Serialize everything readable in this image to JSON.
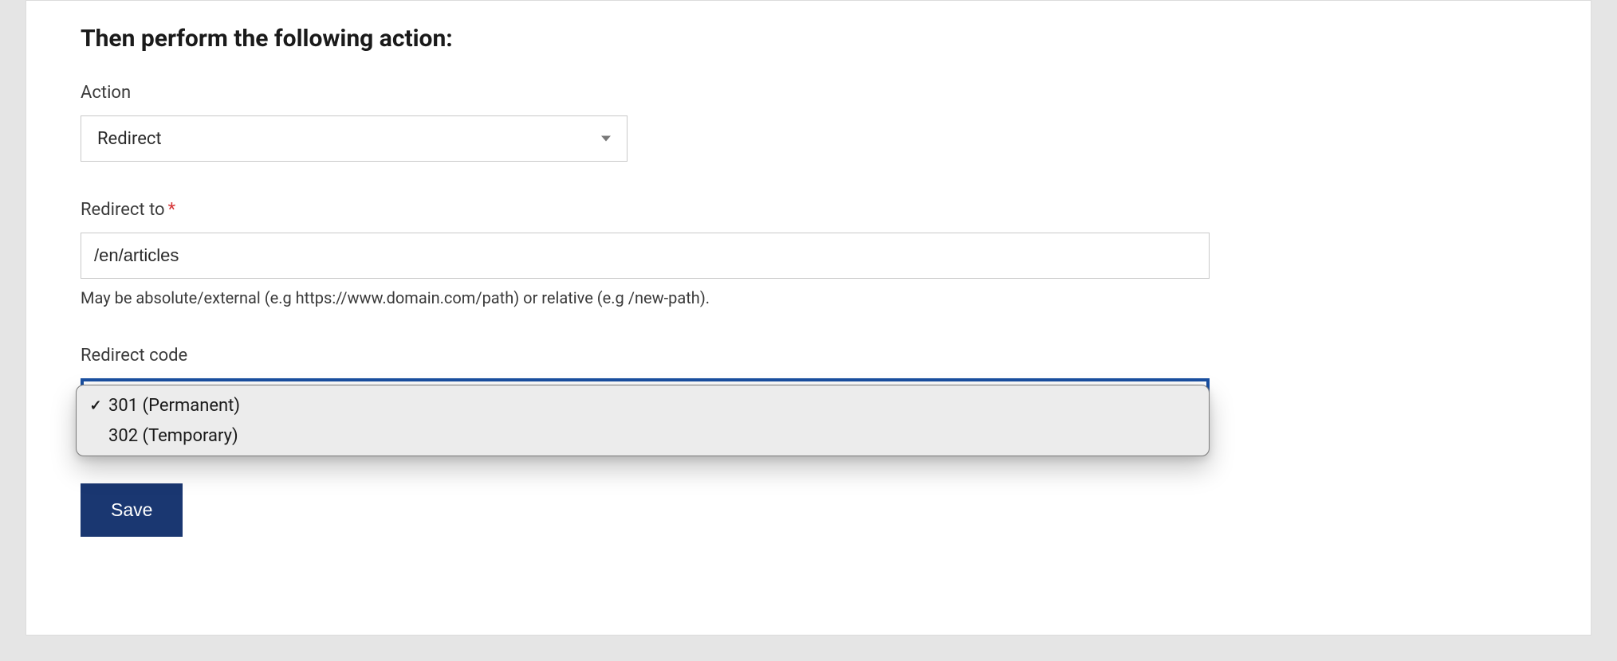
{
  "section": {
    "heading": "Then perform the following action:"
  },
  "action": {
    "label": "Action",
    "selected": "Redirect"
  },
  "redirect_to": {
    "label": "Redirect to",
    "value": "/en/articles",
    "help": "May be absolute/external (e.g https://www.domain.com/path) or relative (e.g /new-path)."
  },
  "redirect_code": {
    "label": "Redirect code",
    "options": [
      {
        "label": "301 (Permanent)",
        "selected": true
      },
      {
        "label": "302 (Temporary)",
        "selected": false
      }
    ]
  },
  "buttons": {
    "save": "Save"
  }
}
